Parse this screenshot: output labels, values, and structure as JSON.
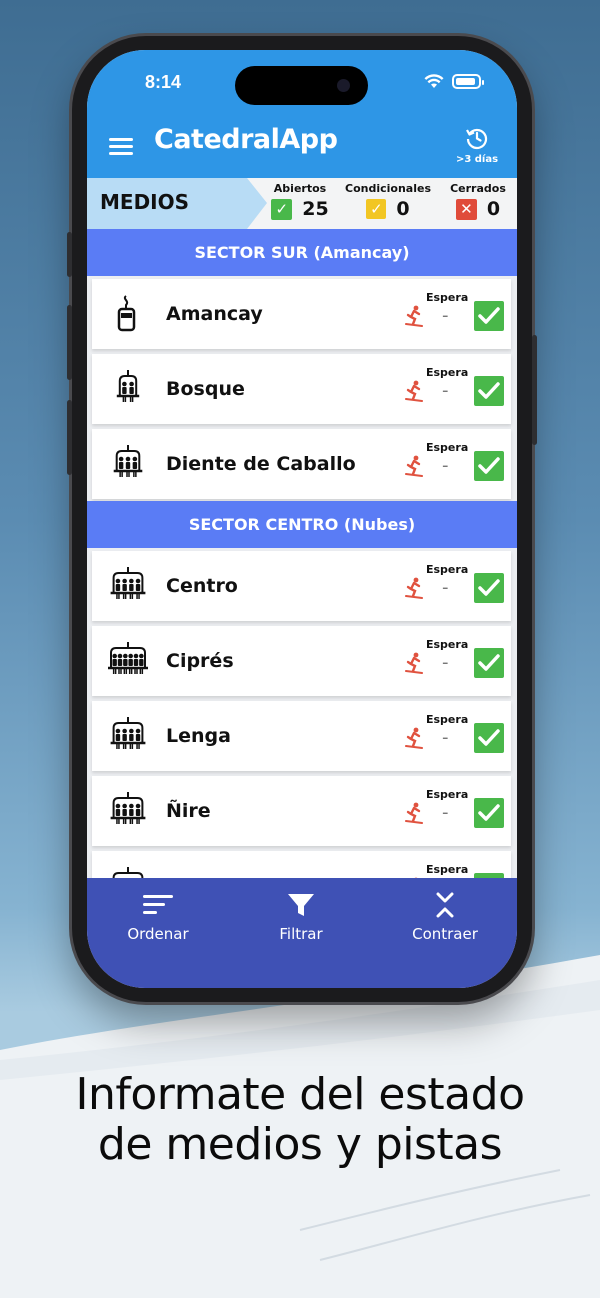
{
  "status_bar": {
    "time": "8:14"
  },
  "app": {
    "title": "CatedralApp",
    "history_label": ">3 días"
  },
  "summary": {
    "title": "MEDIOS",
    "stats": [
      {
        "label": "Abiertos",
        "count": "25",
        "color": "#49b84a",
        "icon": "check"
      },
      {
        "label": "Condicionales",
        "count": "0",
        "color": "#f2c623",
        "icon": "check"
      },
      {
        "label": "Cerrados",
        "count": "0",
        "color": "#e04b3a",
        "icon": "cross"
      }
    ]
  },
  "sectors": [
    {
      "title": "SECTOR SUR (Amancay)",
      "lifts": [
        {
          "name": "Amancay",
          "icon": "gondola-icon",
          "wait_label": "Espera",
          "wait": "-",
          "status": "open"
        },
        {
          "name": "Bosque",
          "icon": "chairlift-2-icon",
          "wait_label": "Espera",
          "wait": "-",
          "status": "open"
        },
        {
          "name": "Diente de Caballo",
          "icon": "chairlift-3-icon",
          "wait_label": "Espera",
          "wait": "-",
          "status": "open"
        }
      ]
    },
    {
      "title": "SECTOR CENTRO (Nubes)",
      "lifts": [
        {
          "name": "Centro",
          "icon": "chairlift-4-icon",
          "wait_label": "Espera",
          "wait": "-",
          "status": "open"
        },
        {
          "name": "Ciprés",
          "icon": "chairlift-6-icon",
          "wait_label": "Espera",
          "wait": "-",
          "status": "open"
        },
        {
          "name": "Lenga",
          "icon": "chairlift-4-icon",
          "wait_label": "Espera",
          "wait": "-",
          "status": "open"
        },
        {
          "name": "Ñire",
          "icon": "chairlift-4-icon",
          "wait_label": "Espera",
          "wait": "-",
          "status": "open"
        },
        {
          "name": "",
          "icon": "chairlift-icon",
          "wait_label": "Espera",
          "wait": "-",
          "status": "open"
        }
      ]
    }
  ],
  "bottom_nav": [
    {
      "label": "Ordenar",
      "icon": "sort-icon"
    },
    {
      "label": "Filtrar",
      "icon": "filter-icon"
    },
    {
      "label": "Contraer",
      "icon": "collapse-icon"
    }
  ],
  "caption": {
    "line1": "Informate del estado",
    "line2": "de medios y pistas"
  },
  "colors": {
    "app_bar": "#2e96e6",
    "sector": "#5a7cf5",
    "bottom_nav": "#3f51b5",
    "open": "#49b84a"
  }
}
